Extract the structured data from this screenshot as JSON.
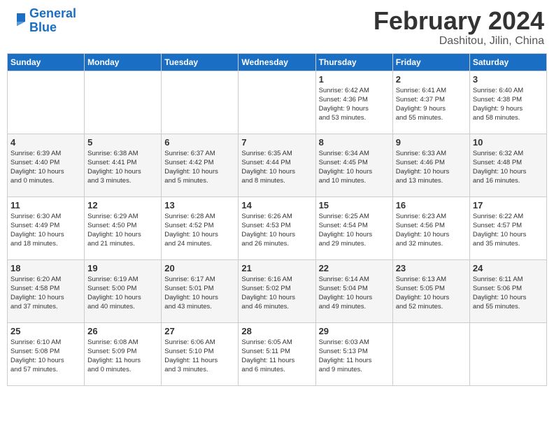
{
  "header": {
    "logo_line1": "General",
    "logo_line2": "Blue",
    "month": "February 2024",
    "location": "Dashitou, Jilin, China"
  },
  "days_of_week": [
    "Sunday",
    "Monday",
    "Tuesday",
    "Wednesday",
    "Thursday",
    "Friday",
    "Saturday"
  ],
  "weeks": [
    [
      {
        "num": "",
        "info": ""
      },
      {
        "num": "",
        "info": ""
      },
      {
        "num": "",
        "info": ""
      },
      {
        "num": "",
        "info": ""
      },
      {
        "num": "1",
        "info": "Sunrise: 6:42 AM\nSunset: 4:36 PM\nDaylight: 9 hours\nand 53 minutes."
      },
      {
        "num": "2",
        "info": "Sunrise: 6:41 AM\nSunset: 4:37 PM\nDaylight: 9 hours\nand 55 minutes."
      },
      {
        "num": "3",
        "info": "Sunrise: 6:40 AM\nSunset: 4:38 PM\nDaylight: 9 hours\nand 58 minutes."
      }
    ],
    [
      {
        "num": "4",
        "info": "Sunrise: 6:39 AM\nSunset: 4:40 PM\nDaylight: 10 hours\nand 0 minutes."
      },
      {
        "num": "5",
        "info": "Sunrise: 6:38 AM\nSunset: 4:41 PM\nDaylight: 10 hours\nand 3 minutes."
      },
      {
        "num": "6",
        "info": "Sunrise: 6:37 AM\nSunset: 4:42 PM\nDaylight: 10 hours\nand 5 minutes."
      },
      {
        "num": "7",
        "info": "Sunrise: 6:35 AM\nSunset: 4:44 PM\nDaylight: 10 hours\nand 8 minutes."
      },
      {
        "num": "8",
        "info": "Sunrise: 6:34 AM\nSunset: 4:45 PM\nDaylight: 10 hours\nand 10 minutes."
      },
      {
        "num": "9",
        "info": "Sunrise: 6:33 AM\nSunset: 4:46 PM\nDaylight: 10 hours\nand 13 minutes."
      },
      {
        "num": "10",
        "info": "Sunrise: 6:32 AM\nSunset: 4:48 PM\nDaylight: 10 hours\nand 16 minutes."
      }
    ],
    [
      {
        "num": "11",
        "info": "Sunrise: 6:30 AM\nSunset: 4:49 PM\nDaylight: 10 hours\nand 18 minutes."
      },
      {
        "num": "12",
        "info": "Sunrise: 6:29 AM\nSunset: 4:50 PM\nDaylight: 10 hours\nand 21 minutes."
      },
      {
        "num": "13",
        "info": "Sunrise: 6:28 AM\nSunset: 4:52 PM\nDaylight: 10 hours\nand 24 minutes."
      },
      {
        "num": "14",
        "info": "Sunrise: 6:26 AM\nSunset: 4:53 PM\nDaylight: 10 hours\nand 26 minutes."
      },
      {
        "num": "15",
        "info": "Sunrise: 6:25 AM\nSunset: 4:54 PM\nDaylight: 10 hours\nand 29 minutes."
      },
      {
        "num": "16",
        "info": "Sunrise: 6:23 AM\nSunset: 4:56 PM\nDaylight: 10 hours\nand 32 minutes."
      },
      {
        "num": "17",
        "info": "Sunrise: 6:22 AM\nSunset: 4:57 PM\nDaylight: 10 hours\nand 35 minutes."
      }
    ],
    [
      {
        "num": "18",
        "info": "Sunrise: 6:20 AM\nSunset: 4:58 PM\nDaylight: 10 hours\nand 37 minutes."
      },
      {
        "num": "19",
        "info": "Sunrise: 6:19 AM\nSunset: 5:00 PM\nDaylight: 10 hours\nand 40 minutes."
      },
      {
        "num": "20",
        "info": "Sunrise: 6:17 AM\nSunset: 5:01 PM\nDaylight: 10 hours\nand 43 minutes."
      },
      {
        "num": "21",
        "info": "Sunrise: 6:16 AM\nSunset: 5:02 PM\nDaylight: 10 hours\nand 46 minutes."
      },
      {
        "num": "22",
        "info": "Sunrise: 6:14 AM\nSunset: 5:04 PM\nDaylight: 10 hours\nand 49 minutes."
      },
      {
        "num": "23",
        "info": "Sunrise: 6:13 AM\nSunset: 5:05 PM\nDaylight: 10 hours\nand 52 minutes."
      },
      {
        "num": "24",
        "info": "Sunrise: 6:11 AM\nSunset: 5:06 PM\nDaylight: 10 hours\nand 55 minutes."
      }
    ],
    [
      {
        "num": "25",
        "info": "Sunrise: 6:10 AM\nSunset: 5:08 PM\nDaylight: 10 hours\nand 57 minutes."
      },
      {
        "num": "26",
        "info": "Sunrise: 6:08 AM\nSunset: 5:09 PM\nDaylight: 11 hours\nand 0 minutes."
      },
      {
        "num": "27",
        "info": "Sunrise: 6:06 AM\nSunset: 5:10 PM\nDaylight: 11 hours\nand 3 minutes."
      },
      {
        "num": "28",
        "info": "Sunrise: 6:05 AM\nSunset: 5:11 PM\nDaylight: 11 hours\nand 6 minutes."
      },
      {
        "num": "29",
        "info": "Sunrise: 6:03 AM\nSunset: 5:13 PM\nDaylight: 11 hours\nand 9 minutes."
      },
      {
        "num": "",
        "info": ""
      },
      {
        "num": "",
        "info": ""
      }
    ]
  ]
}
